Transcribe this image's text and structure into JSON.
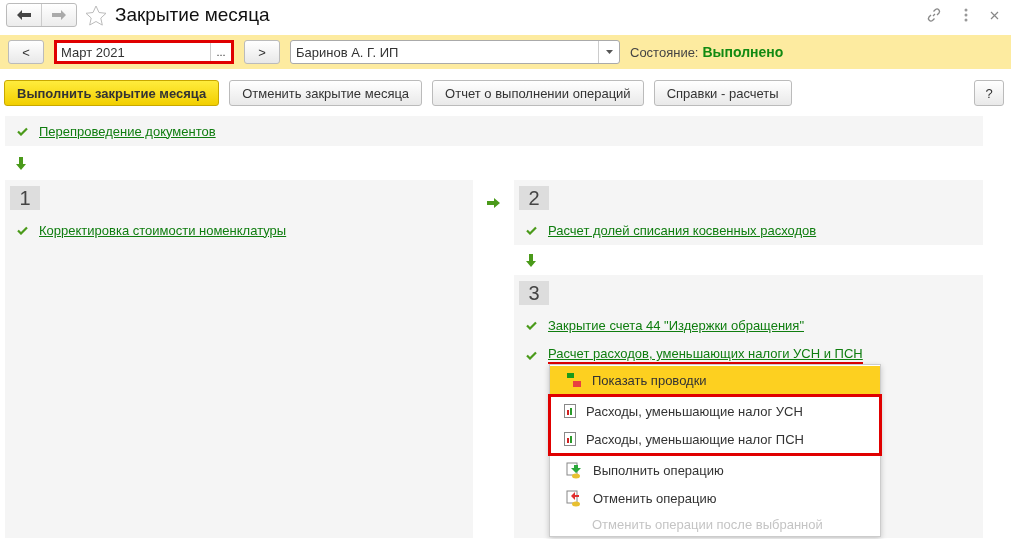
{
  "window": {
    "title": "Закрытие месяца"
  },
  "filter_bar": {
    "prev_button": "<",
    "period": {
      "value": "Март 2021",
      "highlighted": true
    },
    "picker_button": "...",
    "next_button": ">",
    "organization": {
      "value": "Баринов А. Г. ИП"
    },
    "status_label": "Состояние:",
    "status_value": "Выполнено"
  },
  "toolbar": {
    "buttons": [
      {
        "label": "Выполнить закрытие месяца",
        "kind": "primary"
      },
      {
        "label": "Отменить закрытие месяца",
        "kind": "plain"
      },
      {
        "label": "Отчет о выполнении операций",
        "kind": "plain"
      },
      {
        "label": "Справки - расчеты",
        "kind": "plain"
      }
    ],
    "help_button": "?"
  },
  "preliminary": {
    "operations": [
      {
        "label": "Перепроведение документов",
        "done": true,
        "marked": false
      }
    ]
  },
  "stages": [
    {
      "number": "1",
      "operations": [
        {
          "label": "Корректировка стоимости номенклатуры",
          "done": true,
          "marked": false
        }
      ]
    },
    {
      "number": "2",
      "operations": [
        {
          "label": "Расчет долей списания косвенных расходов",
          "done": true,
          "marked": false
        }
      ]
    },
    {
      "number": "3",
      "operations": [
        {
          "label": "Закрытие счета 44 \"Издержки обращения\"",
          "done": true,
          "marked": false
        },
        {
          "label": "Расчет расходов, уменьшающих налоги УСН и ПСН",
          "done": true,
          "marked": true
        }
      ]
    }
  ],
  "context_menu": {
    "items": [
      {
        "label": "Показать проводки",
        "kind": "postings",
        "selected": true,
        "highlighted": false,
        "disabled": false
      },
      {
        "label": "Расходы, уменьшающие налог УСН",
        "kind": "report",
        "selected": false,
        "highlighted": true,
        "disabled": false
      },
      {
        "label": "Расходы, уменьшающие налог ПСН",
        "kind": "report",
        "selected": false,
        "highlighted": true,
        "disabled": false
      },
      {
        "label": "Выполнить операцию",
        "kind": "run",
        "selected": false,
        "highlighted": false,
        "disabled": false
      },
      {
        "label": "Отменить операцию",
        "kind": "cancel",
        "selected": false,
        "highlighted": false,
        "disabled": false
      },
      {
        "label": "Отменить операции после выбранной",
        "kind": "plain",
        "selected": false,
        "highlighted": false,
        "disabled": true
      }
    ]
  }
}
